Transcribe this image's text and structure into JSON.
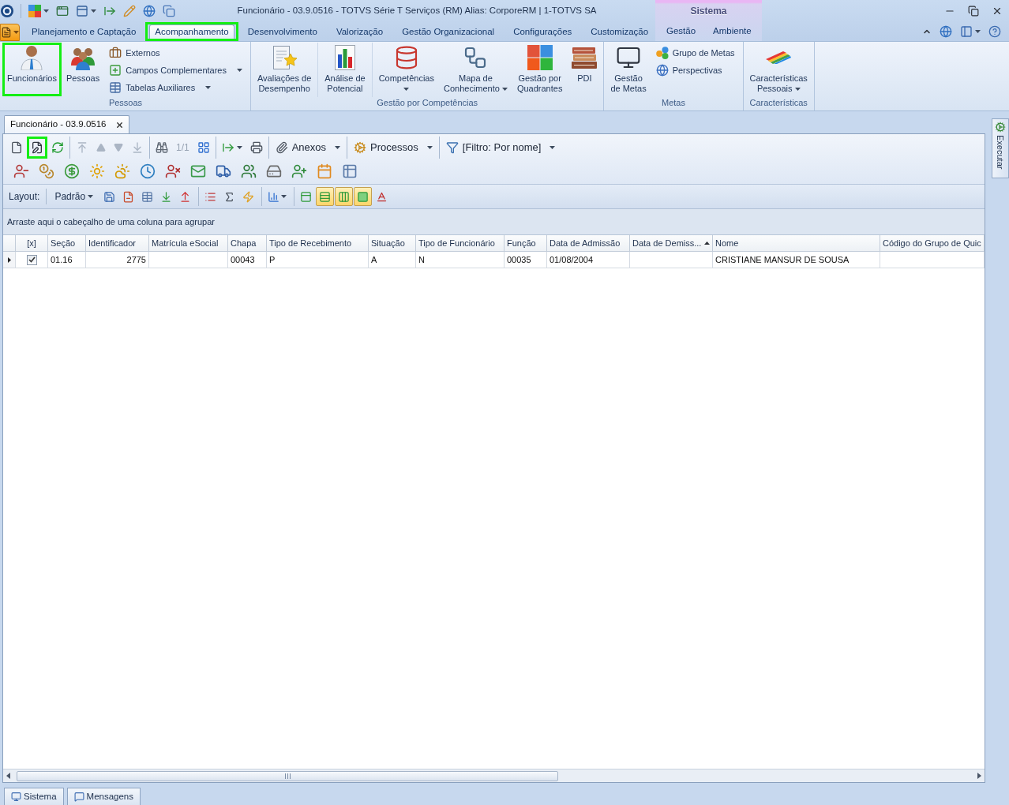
{
  "title_bar": {
    "title": "Funcionário - 03.9.0516 - TOTVS Série T Serviços (RM) Alias: CorporeRM | 1-TOTVS SA"
  },
  "ribbon_tabs": [
    {
      "label": "Planejamento e Captação",
      "selected": false,
      "highlighted": false
    },
    {
      "label": "Acompanhamento",
      "selected": true,
      "highlighted": true
    },
    {
      "label": "Desenvolvimento",
      "selected": false,
      "highlighted": false
    },
    {
      "label": "Valorização",
      "selected": false,
      "highlighted": false
    },
    {
      "label": "Gestão Organizacional",
      "selected": false,
      "highlighted": false
    },
    {
      "label": "Configurações",
      "selected": false,
      "highlighted": false
    },
    {
      "label": "Customização",
      "selected": false,
      "highlighted": false
    }
  ],
  "context_tab_group": {
    "label": "Sistema",
    "tabs": [
      {
        "label": "Gestão",
        "selected": false
      },
      {
        "label": "Ambiente",
        "selected": false
      }
    ]
  },
  "ribbon_groups": [
    {
      "label": "Pessoas",
      "sections": [
        {
          "large_buttons": [
            {
              "lines": [
                "Funcionários"
              ],
              "dropdown": false,
              "highlighted": true
            },
            {
              "lines": [
                "Pessoas"
              ],
              "dropdown": false,
              "highlighted": false
            }
          ],
          "small_buttons": [
            {
              "label": "Externos",
              "dropdown": false
            },
            {
              "label": "Campos Complementares",
              "dropdown": true
            },
            {
              "label": "Tabelas Auxiliares",
              "dropdown": true
            }
          ]
        }
      ]
    },
    {
      "label": "Gestão por Competências",
      "sections": [
        {
          "large_buttons": [
            {
              "lines": [
                "Avaliações de",
                "Desempenho"
              ],
              "dropdown": false,
              "highlighted": false
            }
          ]
        },
        {
          "large_buttons": [
            {
              "lines": [
                "Análise de",
                "Potencial"
              ],
              "dropdown": false,
              "highlighted": false
            }
          ]
        },
        {
          "large_buttons": [
            {
              "lines": [
                "Competências"
              ],
              "dropdown": true,
              "highlighted": false
            },
            {
              "lines": [
                "Mapa de",
                "Conhecimento"
              ],
              "dropdown": true,
              "highlighted": false
            },
            {
              "lines": [
                "Gestão por",
                "Quadrantes"
              ],
              "dropdown": false,
              "highlighted": false
            },
            {
              "lines": [
                "PDI"
              ],
              "dropdown": false,
              "highlighted": false
            }
          ]
        }
      ]
    },
    {
      "label": "Metas",
      "sections": [
        {
          "large_buttons": [
            {
              "lines": [
                "Gestão",
                "de Metas"
              ],
              "dropdown": false,
              "highlighted": false
            }
          ],
          "small_buttons": [
            {
              "label": "Grupo de Metas",
              "dropdown": false
            },
            {
              "label": "Perspectivas",
              "dropdown": false
            }
          ]
        }
      ]
    },
    {
      "label": "Características",
      "sections": [
        {
          "large_buttons": [
            {
              "lines": [
                "Características",
                "Pessoais"
              ],
              "dropdown": true,
              "highlighted": false
            }
          ]
        }
      ]
    }
  ],
  "document_tabs": [
    {
      "label": "Funcionário - 03.9.0516",
      "selected": true
    }
  ],
  "toolbar": {
    "groups": [
      [
        {
          "kind": "icon",
          "disabled": false,
          "highlighted": false,
          "dropdown": false
        },
        {
          "kind": "icon",
          "disabled": false,
          "highlighted": true,
          "dropdown": false
        },
        {
          "kind": "icon",
          "disabled": false,
          "highlighted": false,
          "dropdown": false
        }
      ],
      [
        {
          "kind": "icon",
          "disabled": true,
          "highlighted": false,
          "dropdown": false
        },
        {
          "kind": "icon",
          "disabled": true,
          "highlighted": false,
          "dropdown": false
        },
        {
          "kind": "icon",
          "disabled": true,
          "highlighted": false,
          "dropdown": false
        },
        {
          "kind": "icon",
          "disabled": true,
          "highlighted": false,
          "dropdown": false
        }
      ],
      [
        {
          "kind": "icon",
          "disabled": false,
          "highlighted": false,
          "dropdown": false
        },
        {
          "kind": "counter",
          "label": "1/1",
          "disabled": true,
          "highlighted": false,
          "dropdown": false
        },
        {
          "kind": "icon",
          "disabled": false,
          "highlighted": false,
          "dropdown": false
        }
      ],
      [
        {
          "kind": "icon",
          "disabled": false,
          "highlighted": false,
          "dropdown": true
        },
        {
          "kind": "icon",
          "disabled": false,
          "highlighted": false,
          "dropdown": false
        }
      ],
      [
        {
          "kind": "menu",
          "label": "Anexos",
          "disabled": false,
          "highlighted": false,
          "dropdown": true
        }
      ],
      [
        {
          "kind": "menu",
          "label": "Processos",
          "disabled": false,
          "highlighted": false,
          "dropdown": true
        }
      ],
      [
        {
          "kind": "menu",
          "label": "[Filtro: Por nome]",
          "disabled": false,
          "highlighted": false,
          "dropdown": true
        }
      ]
    ]
  },
  "layout_bar": {
    "label": "Layout:",
    "preset": {
      "label": "Padrão",
      "dropdown": true
    },
    "groups": [
      [
        {
          "on": false,
          "dropdown": false
        },
        {
          "on": false,
          "dropdown": false
        },
        {
          "on": false,
          "dropdown": false
        },
        {
          "on": false,
          "dropdown": false
        },
        {
          "on": false,
          "dropdown": false
        }
      ],
      [
        {
          "on": false,
          "dropdown": false
        },
        {
          "on": false,
          "dropdown": false
        },
        {
          "on": false,
          "dropdown": false
        }
      ],
      [
        {
          "on": false,
          "dropdown": true
        }
      ],
      [
        {
          "on": false,
          "dropdown": false
        },
        {
          "on": true,
          "dropdown": false
        },
        {
          "on": true,
          "dropdown": false
        },
        {
          "on": true,
          "dropdown": false
        },
        {
          "on": false,
          "dropdown": false
        }
      ]
    ]
  },
  "grid": {
    "group_panel": "Arraste aqui o cabeçalho de uma coluna para agrupar",
    "columns": [
      {
        "label": "[x]",
        "kind": "check",
        "sorted": false
      },
      {
        "label": "Seção",
        "kind": "text",
        "sorted": false
      },
      {
        "label": "Identificador",
        "kind": "number",
        "sorted": false
      },
      {
        "label": "Matrícula eSocial",
        "kind": "text",
        "sorted": false
      },
      {
        "label": "Chapa",
        "kind": "text",
        "sorted": false
      },
      {
        "label": "Tipo de Recebimento",
        "kind": "text",
        "sorted": false
      },
      {
        "label": "Situação",
        "kind": "text",
        "sorted": false
      },
      {
        "label": "Tipo de Funcionário",
        "kind": "text",
        "sorted": false
      },
      {
        "label": "Função",
        "kind": "text",
        "sorted": false
      },
      {
        "label": "Data de Admissão",
        "kind": "text",
        "sorted": false
      },
      {
        "label": "Data de Demiss...",
        "kind": "text",
        "sorted": true
      },
      {
        "label": "Nome",
        "kind": "text",
        "sorted": false
      },
      {
        "label": "Código do Grupo de Quic",
        "kind": "text",
        "sorted": false
      }
    ],
    "rows": [
      {
        "current": true,
        "checked": true,
        "cells": [
          "",
          "01.16",
          "2775",
          "",
          "00043",
          "P",
          "A",
          "N",
          "00035",
          "01/08/2004",
          "",
          "CRISTIANE MANSUR DE SOUSA",
          ""
        ]
      }
    ]
  },
  "side_panel": {
    "label": "Executar"
  },
  "status_tabs": [
    {
      "label": "Sistema"
    },
    {
      "label": "Mensagens"
    }
  ]
}
